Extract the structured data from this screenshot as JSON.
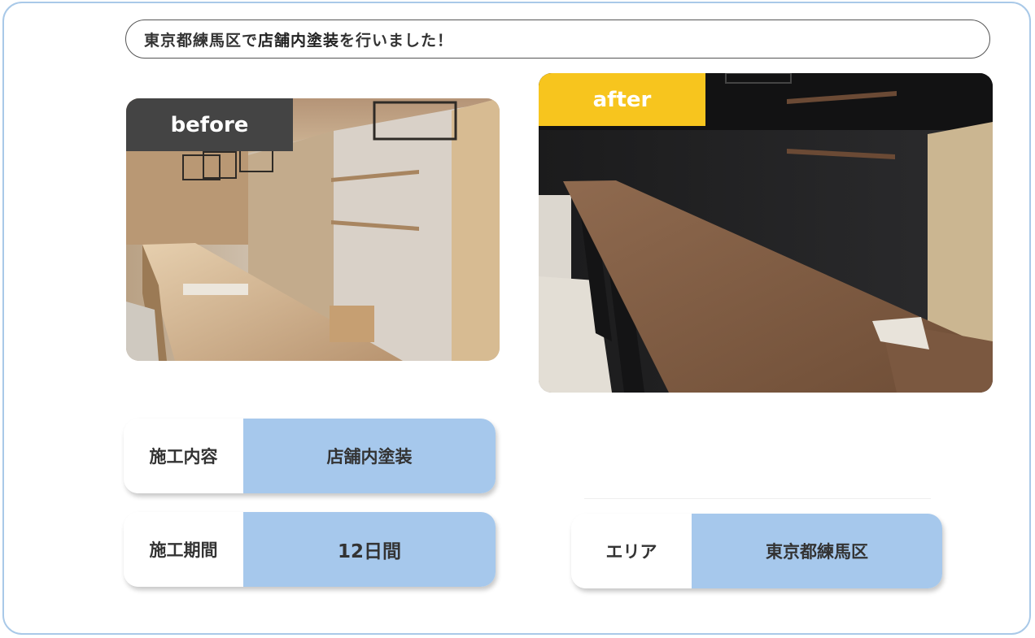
{
  "title": {
    "prefix": "東京都練馬区で",
    "highlight": "店舗内塗装",
    "suffix": "を行いました！"
  },
  "photos": {
    "before_label": "before",
    "after_label": "after"
  },
  "info": {
    "work_label": "施工内容",
    "work_value": "店舗内塗装",
    "period_label": "施工期間",
    "period_value": "12日間",
    "area_label": "エリア",
    "area_value": "東京都練馬区"
  },
  "colors": {
    "frame_border": "#a9c9e8",
    "value_bg": "#a6c8ec",
    "before_tag": "#444444",
    "after_tag": "#f7c51e"
  }
}
